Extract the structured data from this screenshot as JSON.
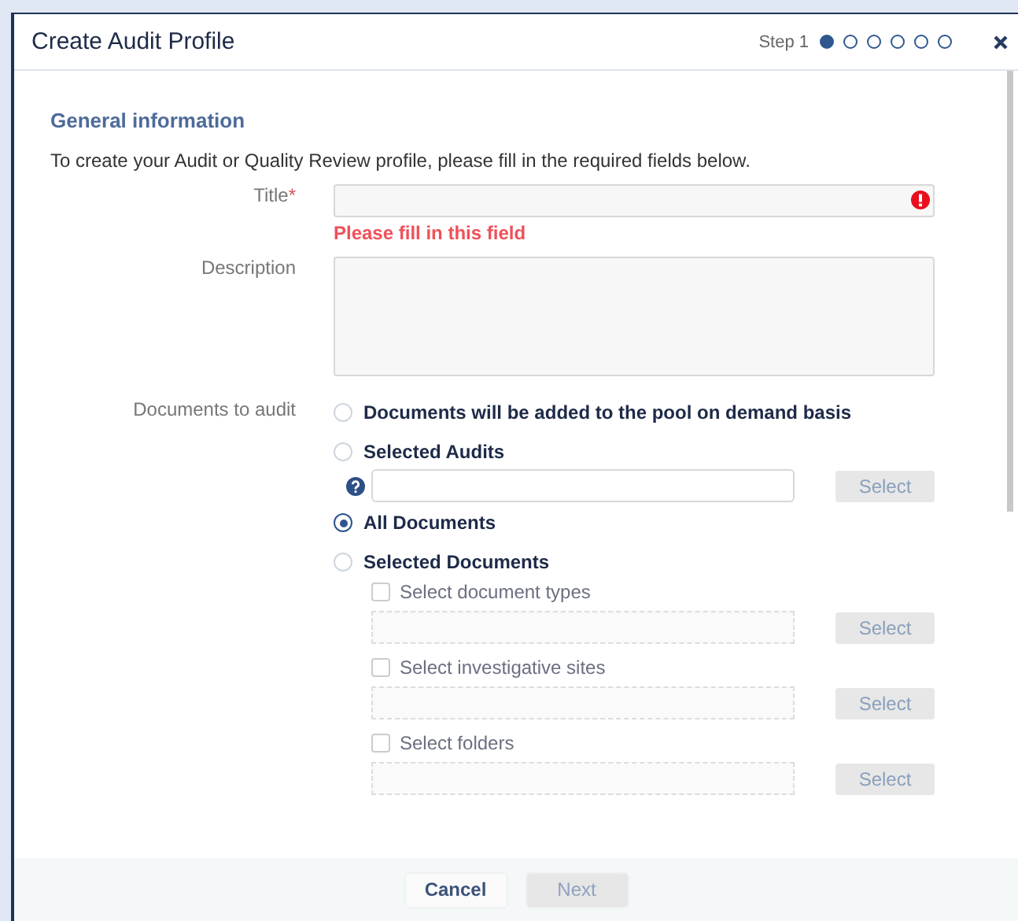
{
  "dialog": {
    "title": "Create Audit Profile",
    "step_label": "Step 1",
    "steps": [
      {
        "selected": true
      },
      {
        "selected": false
      },
      {
        "selected": false
      },
      {
        "selected": false
      },
      {
        "selected": false
      },
      {
        "selected": false
      }
    ]
  },
  "section_title": "General information",
  "intro": "To create your Audit or Quality Review profile, please fill in the required fields below.",
  "title_field": {
    "label": "Title",
    "required_mark": "*",
    "invalid": true,
    "error": "Please fill in this field"
  },
  "description_field": {
    "label": "Description"
  },
  "documents": {
    "label": "Documents to audit",
    "options": [
      {
        "label": "Documents will be added to the pool on demand basis",
        "selected": false
      },
      {
        "label": "Selected Audits",
        "selected": false,
        "picker": {
          "button": "Select"
        }
      },
      {
        "label": "All Documents",
        "selected": true
      },
      {
        "label": "Selected Documents",
        "selected": false,
        "children": [
          {
            "label": "Select document types",
            "checked": false,
            "button": "Select"
          },
          {
            "label": "Select investigative sites",
            "checked": false,
            "button": "Select"
          },
          {
            "label": "Select folders",
            "checked": false,
            "button": "Select"
          }
        ]
      }
    ]
  },
  "footer_buttons": [
    {
      "label": "Cancel",
      "disabled": false
    },
    {
      "label": "Next",
      "disabled": true
    }
  ]
}
